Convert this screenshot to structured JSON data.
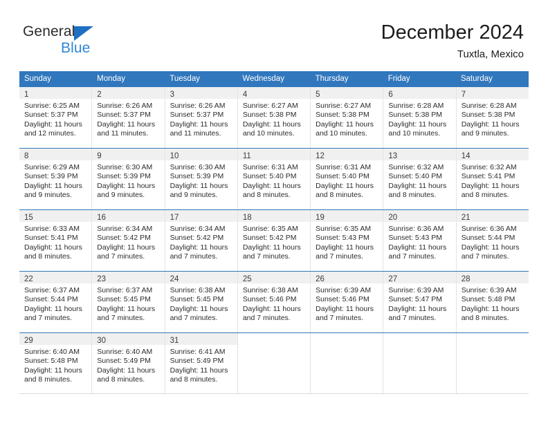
{
  "logo": {
    "primary_text": "General",
    "secondary_text": "Blue",
    "primary_color": "#2b2b2b",
    "secondary_color": "#2e86d4",
    "triangle_color": "#1f6fc4"
  },
  "header": {
    "title": "December 2024",
    "subtitle": "Tuxtla, Mexico"
  },
  "theme": {
    "header_row_bg": "#3077bd",
    "header_row_text": "#ffffff",
    "daynum_band_bg": "#f0f0f0",
    "row_divider": "#3077bd",
    "cell_divider": "#e3e3e3"
  },
  "weekdays": [
    "Sunday",
    "Monday",
    "Tuesday",
    "Wednesday",
    "Thursday",
    "Friday",
    "Saturday"
  ],
  "weeks": [
    [
      {
        "day": "1",
        "sunrise": "Sunrise: 6:25 AM",
        "sunset": "Sunset: 5:37 PM",
        "daylight": "Daylight: 11 hours and 12 minutes."
      },
      {
        "day": "2",
        "sunrise": "Sunrise: 6:26 AM",
        "sunset": "Sunset: 5:37 PM",
        "daylight": "Daylight: 11 hours and 11 minutes."
      },
      {
        "day": "3",
        "sunrise": "Sunrise: 6:26 AM",
        "sunset": "Sunset: 5:37 PM",
        "daylight": "Daylight: 11 hours and 11 minutes."
      },
      {
        "day": "4",
        "sunrise": "Sunrise: 6:27 AM",
        "sunset": "Sunset: 5:38 PM",
        "daylight": "Daylight: 11 hours and 10 minutes."
      },
      {
        "day": "5",
        "sunrise": "Sunrise: 6:27 AM",
        "sunset": "Sunset: 5:38 PM",
        "daylight": "Daylight: 11 hours and 10 minutes."
      },
      {
        "day": "6",
        "sunrise": "Sunrise: 6:28 AM",
        "sunset": "Sunset: 5:38 PM",
        "daylight": "Daylight: 11 hours and 10 minutes."
      },
      {
        "day": "7",
        "sunrise": "Sunrise: 6:28 AM",
        "sunset": "Sunset: 5:38 PM",
        "daylight": "Daylight: 11 hours and 9 minutes."
      }
    ],
    [
      {
        "day": "8",
        "sunrise": "Sunrise: 6:29 AM",
        "sunset": "Sunset: 5:39 PM",
        "daylight": "Daylight: 11 hours and 9 minutes."
      },
      {
        "day": "9",
        "sunrise": "Sunrise: 6:30 AM",
        "sunset": "Sunset: 5:39 PM",
        "daylight": "Daylight: 11 hours and 9 minutes."
      },
      {
        "day": "10",
        "sunrise": "Sunrise: 6:30 AM",
        "sunset": "Sunset: 5:39 PM",
        "daylight": "Daylight: 11 hours and 9 minutes."
      },
      {
        "day": "11",
        "sunrise": "Sunrise: 6:31 AM",
        "sunset": "Sunset: 5:40 PM",
        "daylight": "Daylight: 11 hours and 8 minutes."
      },
      {
        "day": "12",
        "sunrise": "Sunrise: 6:31 AM",
        "sunset": "Sunset: 5:40 PM",
        "daylight": "Daylight: 11 hours and 8 minutes."
      },
      {
        "day": "13",
        "sunrise": "Sunrise: 6:32 AM",
        "sunset": "Sunset: 5:40 PM",
        "daylight": "Daylight: 11 hours and 8 minutes."
      },
      {
        "day": "14",
        "sunrise": "Sunrise: 6:32 AM",
        "sunset": "Sunset: 5:41 PM",
        "daylight": "Daylight: 11 hours and 8 minutes."
      }
    ],
    [
      {
        "day": "15",
        "sunrise": "Sunrise: 6:33 AM",
        "sunset": "Sunset: 5:41 PM",
        "daylight": "Daylight: 11 hours and 8 minutes."
      },
      {
        "day": "16",
        "sunrise": "Sunrise: 6:34 AM",
        "sunset": "Sunset: 5:42 PM",
        "daylight": "Daylight: 11 hours and 7 minutes."
      },
      {
        "day": "17",
        "sunrise": "Sunrise: 6:34 AM",
        "sunset": "Sunset: 5:42 PM",
        "daylight": "Daylight: 11 hours and 7 minutes."
      },
      {
        "day": "18",
        "sunrise": "Sunrise: 6:35 AM",
        "sunset": "Sunset: 5:42 PM",
        "daylight": "Daylight: 11 hours and 7 minutes."
      },
      {
        "day": "19",
        "sunrise": "Sunrise: 6:35 AM",
        "sunset": "Sunset: 5:43 PM",
        "daylight": "Daylight: 11 hours and 7 minutes."
      },
      {
        "day": "20",
        "sunrise": "Sunrise: 6:36 AM",
        "sunset": "Sunset: 5:43 PM",
        "daylight": "Daylight: 11 hours and 7 minutes."
      },
      {
        "day": "21",
        "sunrise": "Sunrise: 6:36 AM",
        "sunset": "Sunset: 5:44 PM",
        "daylight": "Daylight: 11 hours and 7 minutes."
      }
    ],
    [
      {
        "day": "22",
        "sunrise": "Sunrise: 6:37 AM",
        "sunset": "Sunset: 5:44 PM",
        "daylight": "Daylight: 11 hours and 7 minutes."
      },
      {
        "day": "23",
        "sunrise": "Sunrise: 6:37 AM",
        "sunset": "Sunset: 5:45 PM",
        "daylight": "Daylight: 11 hours and 7 minutes."
      },
      {
        "day": "24",
        "sunrise": "Sunrise: 6:38 AM",
        "sunset": "Sunset: 5:45 PM",
        "daylight": "Daylight: 11 hours and 7 minutes."
      },
      {
        "day": "25",
        "sunrise": "Sunrise: 6:38 AM",
        "sunset": "Sunset: 5:46 PM",
        "daylight": "Daylight: 11 hours and 7 minutes."
      },
      {
        "day": "26",
        "sunrise": "Sunrise: 6:39 AM",
        "sunset": "Sunset: 5:46 PM",
        "daylight": "Daylight: 11 hours and 7 minutes."
      },
      {
        "day": "27",
        "sunrise": "Sunrise: 6:39 AM",
        "sunset": "Sunset: 5:47 PM",
        "daylight": "Daylight: 11 hours and 7 minutes."
      },
      {
        "day": "28",
        "sunrise": "Sunrise: 6:39 AM",
        "sunset": "Sunset: 5:48 PM",
        "daylight": "Daylight: 11 hours and 8 minutes."
      }
    ],
    [
      {
        "day": "29",
        "sunrise": "Sunrise: 6:40 AM",
        "sunset": "Sunset: 5:48 PM",
        "daylight": "Daylight: 11 hours and 8 minutes."
      },
      {
        "day": "30",
        "sunrise": "Sunrise: 6:40 AM",
        "sunset": "Sunset: 5:49 PM",
        "daylight": "Daylight: 11 hours and 8 minutes."
      },
      {
        "day": "31",
        "sunrise": "Sunrise: 6:41 AM",
        "sunset": "Sunset: 5:49 PM",
        "daylight": "Daylight: 11 hours and 8 minutes."
      },
      {
        "day": "",
        "sunrise": "",
        "sunset": "",
        "daylight": ""
      },
      {
        "day": "",
        "sunrise": "",
        "sunset": "",
        "daylight": ""
      },
      {
        "day": "",
        "sunrise": "",
        "sunset": "",
        "daylight": ""
      },
      {
        "day": "",
        "sunrise": "",
        "sunset": "",
        "daylight": ""
      }
    ]
  ]
}
